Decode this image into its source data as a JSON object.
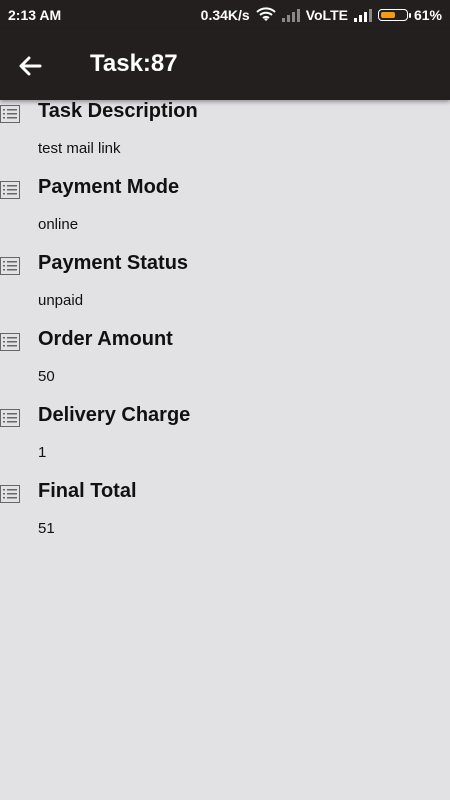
{
  "status_bar": {
    "time": "2:13 AM",
    "network_speed": "0.34K/s",
    "network_type": "VoLTE",
    "battery_percent": "61%",
    "battery_level": 0.61,
    "icons": [
      "wifi-icon",
      "signal-icon",
      "signal-icon",
      "battery-icon"
    ]
  },
  "app_bar": {
    "title": "Task:87",
    "back_icon": "arrow-left-icon"
  },
  "details": [
    {
      "label": "Task Description",
      "value": "test mail link"
    },
    {
      "label": "Payment Mode",
      "value": "online"
    },
    {
      "label": "Payment Status",
      "value": "unpaid"
    },
    {
      "label": "Order Amount",
      "value": "50"
    },
    {
      "label": "Delivery Charge",
      "value": "1"
    },
    {
      "label": "Final Total",
      "value": "51"
    }
  ],
  "colors": {
    "app_bar": "#231f1f",
    "background": "#e2e2e5",
    "battery_fill": "#f39c12"
  }
}
